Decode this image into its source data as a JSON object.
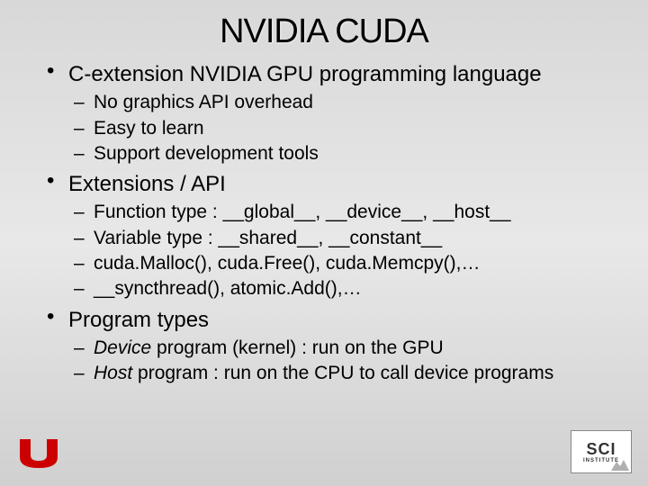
{
  "title": "NVIDIA CUDA",
  "bullets": [
    {
      "text": "C-extension NVIDIA GPU programming language",
      "sub": [
        "No graphics API overhead",
        "Easy to learn",
        "Support development tools"
      ]
    },
    {
      "text": "Extensions / API",
      "sub": [
        "Function type : __global__, __device__, __host__",
        "Variable type : __shared__, __constant__",
        "cuda.Malloc(), cuda.Free(), cuda.Memcpy(),…",
        "__syncthread(), atomic.Add(),…"
      ]
    },
    {
      "text": "Program types",
      "sub_rich": [
        {
          "prefix_italic": "Device",
          "rest": " program (kernel) : run on the GPU"
        },
        {
          "prefix_italic": "Host",
          "rest": " program : run on the CPU to call device programs"
        }
      ]
    }
  ],
  "logos": {
    "left_alt": "University of Utah U logo",
    "right_line1": "SCI",
    "right_line2": "INSTITUTE"
  }
}
